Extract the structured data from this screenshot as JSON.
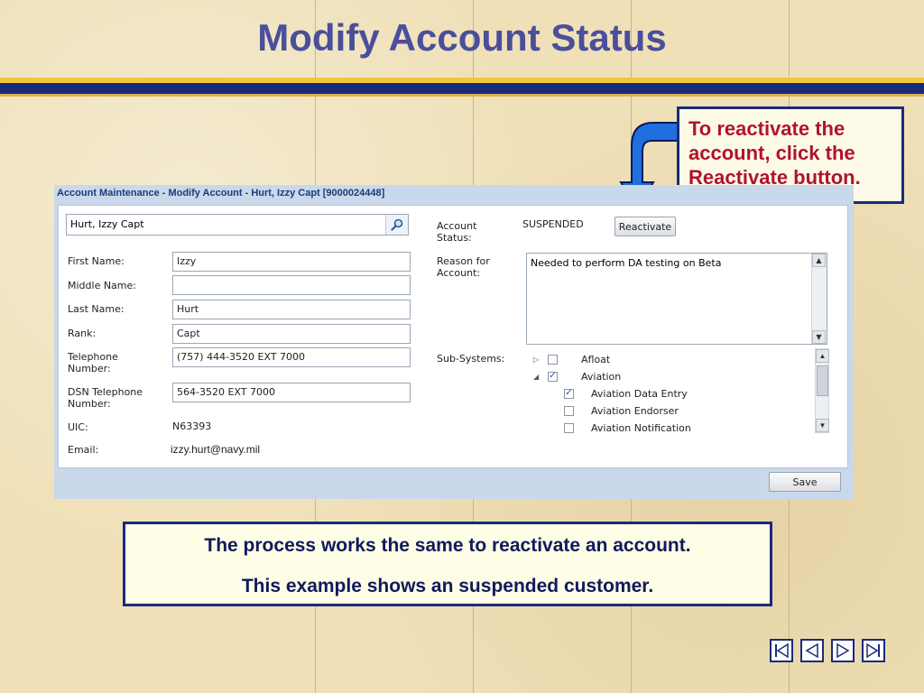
{
  "slide": {
    "title": "Modify Account Status",
    "callout_top": "To reactivate the account, click the Reactivate button.",
    "callout_bottom_line1": "The process works the same to reactivate an account.",
    "callout_bottom_line2": "This example shows an suspended customer."
  },
  "window": {
    "title": "Account Maintenance - Modify Account - Hurt, Izzy Capt [9000024448]",
    "search_value": "Hurt, Izzy Capt",
    "fields": {
      "first_name_label": "First Name:",
      "first_name": "Izzy",
      "middle_name_label": "Middle Name:",
      "middle_name": "",
      "last_name_label": "Last Name:",
      "last_name": "Hurt",
      "rank_label": "Rank:",
      "rank": "Capt",
      "telephone_label": "Telephone Number:",
      "telephone": "(757) 444-3520 EXT 7000",
      "dsn_label": "DSN Telephone Number:",
      "dsn": "564-3520 EXT 7000",
      "uic_label": "UIC:",
      "uic": "N63393",
      "email_label": "Email:",
      "email": "izzy.hurt@navy.mil"
    },
    "account_status_label": "Account Status:",
    "account_status": "SUSPENDED",
    "reactivate_label": "Reactivate",
    "reason_label": "Reason for Account:",
    "reason_value": "Needed to perform DA testing on Beta",
    "subsystems_label": "Sub-Systems:",
    "subsystems": [
      {
        "label": "Afloat",
        "checked": false,
        "expander": "▷",
        "level": 0
      },
      {
        "label": "Aviation",
        "checked": true,
        "expander": "◢",
        "level": 0
      },
      {
        "label": "Aviation Data Entry",
        "checked": true,
        "expander": "",
        "level": 1
      },
      {
        "label": "Aviation Endorser",
        "checked": false,
        "expander": "",
        "level": 1
      },
      {
        "label": "Aviation Notification",
        "checked": false,
        "expander": "",
        "level": 1
      }
    ],
    "save_label": "Save"
  },
  "colors": {
    "title": "#4a4f9c",
    "navy_stripe": "#1a2a7a",
    "gold_stripe": "#f3c63a",
    "callout_text": "#b0142a",
    "arrow_blue": "#1f6fe0"
  },
  "icons": {
    "search": "magnifier-icon",
    "nav": [
      "first-slide-icon",
      "previous-slide-icon",
      "next-slide-icon",
      "last-slide-icon"
    ]
  }
}
